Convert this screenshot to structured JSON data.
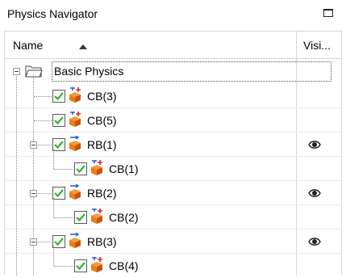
{
  "window": {
    "title": "Physics Navigator"
  },
  "header": {
    "name_col": "Name",
    "vis_col": "Visi..."
  },
  "tree": {
    "root": {
      "label": "Basic Physics"
    },
    "items": [
      {
        "label": "CB(3)",
        "checked": true,
        "visible_icon": false
      },
      {
        "label": "CB(5)",
        "checked": true,
        "visible_icon": false
      },
      {
        "label": "RB(1)",
        "checked": true,
        "visible_icon": true
      },
      {
        "label": "CB(1)",
        "checked": true,
        "visible_icon": false
      },
      {
        "label": "RB(2)",
        "checked": true,
        "visible_icon": true
      },
      {
        "label": "CB(2)",
        "checked": true,
        "visible_icon": false
      },
      {
        "label": "RB(3)",
        "checked": true,
        "visible_icon": true
      },
      {
        "label": "CB(4)",
        "checked": true,
        "visible_icon": false
      }
    ]
  },
  "colors": {
    "check": "#2fb52f",
    "cube_orange": "#f07a1a",
    "cube_dark": "#c4550a",
    "arrow_blue": "#2a60d8",
    "arrow_red": "#d82a2a"
  }
}
